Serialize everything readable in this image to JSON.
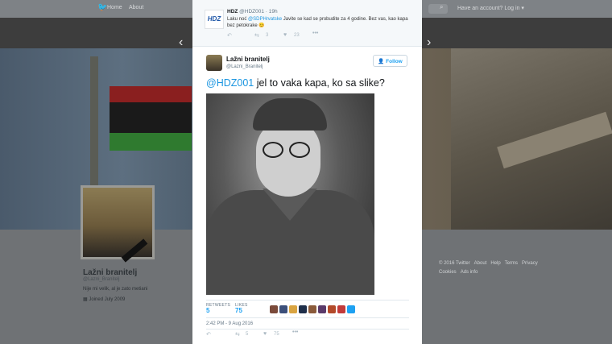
{
  "topbar": {
    "home": "Home",
    "about": "About",
    "account": "Have an account? Log in ▾"
  },
  "profile": {
    "name": "Lažni branitelj",
    "handle": "@Lazni_Branitelj",
    "bio": "Nije mi velik, al je zato metiani",
    "joined": "Joined July 2009"
  },
  "footer": [
    "© 2016 Twitter",
    "About",
    "Help",
    "Terms",
    "Privacy",
    "Cookies",
    "Ads info"
  ],
  "previous_tweet": {
    "logo": "HDZ",
    "name": "HDZ",
    "handle": "@HDZ001",
    "time": "19h",
    "text_pre": "Laku noć ",
    "mention": "@SDPHrvatske",
    "text_post": " Javite se kad se probudite za 4 godine. Bez vas, kao kapa bez petokrake",
    "emoji": "😊",
    "retweets": "3",
    "likes": "23"
  },
  "tweet": {
    "name": "Lažni branitelj",
    "handle": "@Lazni_Branitelj",
    "follow_label": "Follow",
    "mention": "@HDZ001",
    "text": " jel to vaka kapa, ko sa slike?",
    "retweets_label": "RETWEETS",
    "retweets": "5",
    "likes_label": "LIKES",
    "likes": "75",
    "date": "2:42 PM - 9 Aug 2016",
    "action_retweets": "5",
    "action_likes": "75",
    "liker_colors": [
      "#7a4a3a",
      "#3b4f7a",
      "#d9a441",
      "#1f2f4a",
      "#8a5a3a",
      "#5a3a6a",
      "#b34a2a",
      "#c23a3a",
      "#1da1f2"
    ]
  }
}
